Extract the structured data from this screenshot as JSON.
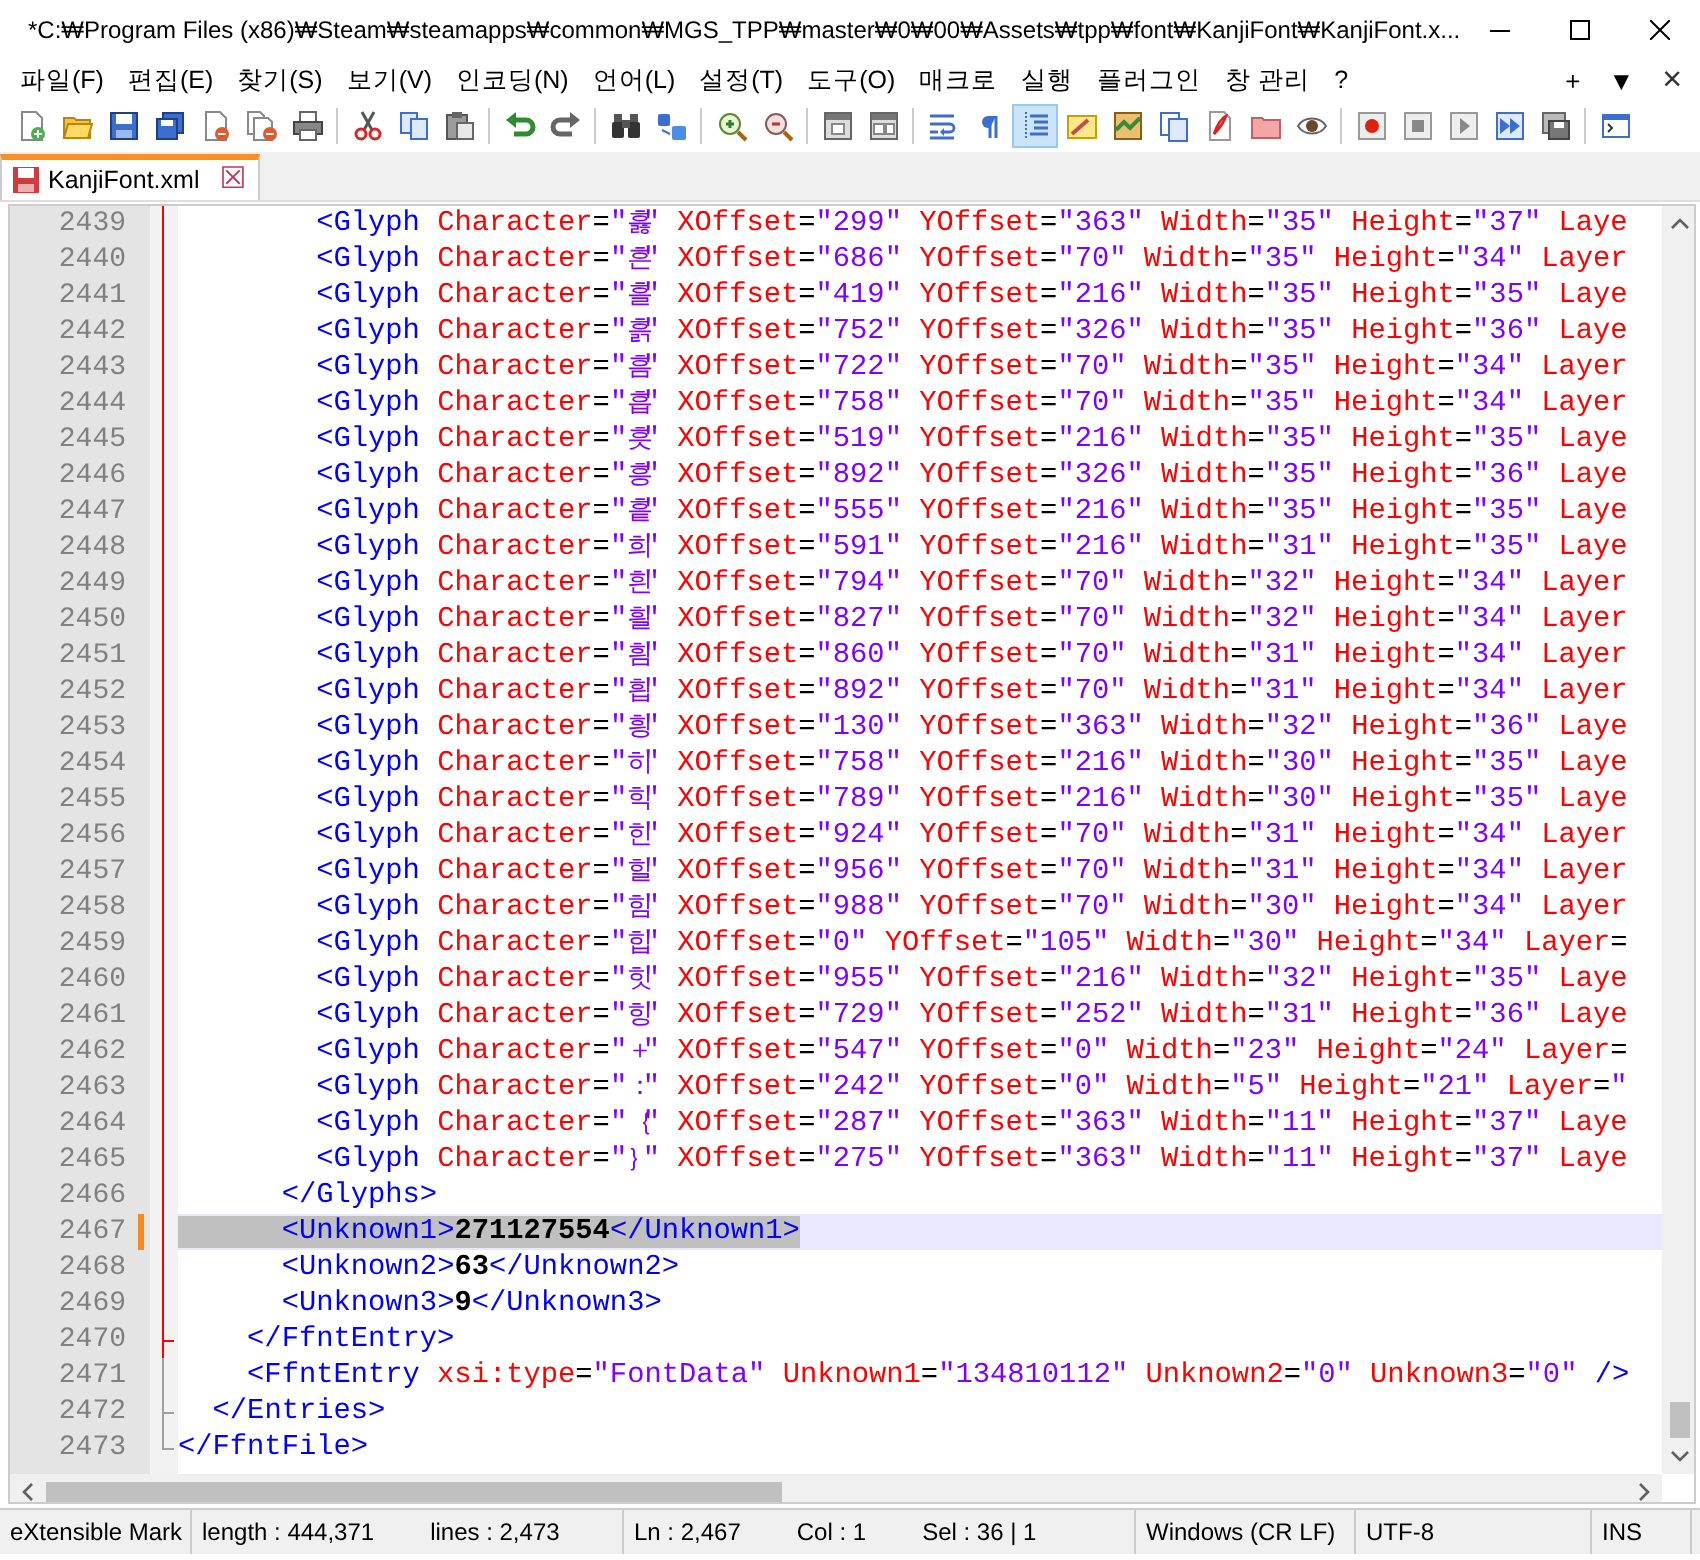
{
  "window": {
    "title": "*C:₩Program Files (x86)₩Steam₩steamapps₩common₩MGS_TPP₩master₩0₩00₩Assets₩tpp₩font₩KanjiFont₩KanjiFont.x..."
  },
  "menu": {
    "items": [
      "파일(F)",
      "편집(E)",
      "찾기(S)",
      "보기(V)",
      "인코딩(N)",
      "언어(L)",
      "설정(T)",
      "도구(O)",
      "매크로",
      "실행",
      "플러그인",
      "창 관리",
      "?"
    ],
    "right": [
      {
        "kind": "plus",
        "label": "+"
      },
      {
        "kind": "dropdown",
        "label": "▼"
      },
      {
        "kind": "close",
        "label": "×"
      }
    ]
  },
  "toolbar": {
    "groups": [
      [
        {
          "kind": "new",
          "pressed": false
        },
        {
          "kind": "open",
          "pressed": false
        },
        {
          "kind": "save",
          "pressed": false
        },
        {
          "kind": "save-all",
          "pressed": false
        },
        {
          "kind": "close",
          "pressed": false
        },
        {
          "kind": "close-all",
          "pressed": false
        },
        {
          "kind": "print",
          "pressed": false
        }
      ],
      [
        {
          "kind": "cut",
          "pressed": false
        },
        {
          "kind": "copy",
          "pressed": false
        },
        {
          "kind": "paste",
          "pressed": false
        }
      ],
      [
        {
          "kind": "undo",
          "pressed": false
        },
        {
          "kind": "redo",
          "pressed": false
        }
      ],
      [
        {
          "kind": "find",
          "pressed": false
        },
        {
          "kind": "replace",
          "pressed": false
        }
      ],
      [
        {
          "kind": "zoom-in",
          "pressed": false
        },
        {
          "kind": "zoom-out",
          "pressed": false
        }
      ],
      [
        {
          "kind": "sync-v",
          "pressed": false
        },
        {
          "kind": "sync-h",
          "pressed": false
        }
      ],
      [
        {
          "kind": "wrap",
          "pressed": false
        },
        {
          "kind": "pilcrow",
          "pressed": false
        },
        {
          "kind": "indent-guide",
          "pressed": true
        },
        {
          "kind": "user-lang",
          "pressed": false
        },
        {
          "kind": "doc-map",
          "pressed": false
        },
        {
          "kind": "func-list",
          "pressed": false
        },
        {
          "kind": "document",
          "pressed": false
        },
        {
          "kind": "folder",
          "pressed": false
        },
        {
          "kind": "eye",
          "pressed": false
        }
      ],
      [
        {
          "kind": "record",
          "pressed": false
        },
        {
          "kind": "stop",
          "pressed": false
        },
        {
          "kind": "play",
          "pressed": false
        },
        {
          "kind": "play-multi",
          "pressed": false
        },
        {
          "kind": "save-macro",
          "pressed": false
        }
      ],
      [
        {
          "kind": "console",
          "pressed": false
        }
      ]
    ]
  },
  "tabs": [
    {
      "label": "KanjiFont.xml",
      "selected": true,
      "modified": true,
      "close": "☒"
    }
  ],
  "editor": {
    "lines": [
      {
        "number": "2439",
        "kind": "inner",
        "current": false,
        "selected": false,
        "changed": false,
        "text": "        <Glyph Character=\"흟\" XOffset=\"299\" YOffset=\"363\" Width=\"35\" Height=\"37\" Laye"
      },
      {
        "number": "2440",
        "kind": "inner",
        "current": false,
        "selected": false,
        "changed": false,
        "text": "        <Glyph Character=\"흔\" XOffset=\"686\" YOffset=\"70\" Width=\"35\" Height=\"34\" Layer"
      },
      {
        "number": "2441",
        "kind": "inner",
        "current": false,
        "selected": false,
        "changed": false,
        "text": "        <Glyph Character=\"흘\" XOffset=\"419\" YOffset=\"216\" Width=\"35\" Height=\"35\" Laye"
      },
      {
        "number": "2442",
        "kind": "inner",
        "current": false,
        "selected": false,
        "changed": false,
        "text": "        <Glyph Character=\"흙\" XOffset=\"752\" YOffset=\"326\" Width=\"35\" Height=\"36\" Laye"
      },
      {
        "number": "2443",
        "kind": "inner",
        "current": false,
        "selected": false,
        "changed": false,
        "text": "        <Glyph Character=\"흠\" XOffset=\"722\" YOffset=\"70\" Width=\"35\" Height=\"34\" Layer"
      },
      {
        "number": "2444",
        "kind": "inner",
        "current": false,
        "selected": false,
        "changed": false,
        "text": "        <Glyph Character=\"흡\" XOffset=\"758\" YOffset=\"70\" Width=\"35\" Height=\"34\" Layer"
      },
      {
        "number": "2445",
        "kind": "inner",
        "current": false,
        "selected": false,
        "changed": false,
        "text": "        <Glyph Character=\"흣\" XOffset=\"519\" YOffset=\"216\" Width=\"35\" Height=\"35\" Laye"
      },
      {
        "number": "2446",
        "kind": "inner",
        "current": false,
        "selected": false,
        "changed": false,
        "text": "        <Glyph Character=\"흥\" XOffset=\"892\" YOffset=\"326\" Width=\"35\" Height=\"36\" Laye"
      },
      {
        "number": "2447",
        "kind": "inner",
        "current": false,
        "selected": false,
        "changed": false,
        "text": "        <Glyph Character=\"흩\" XOffset=\"555\" YOffset=\"216\" Width=\"35\" Height=\"35\" Laye"
      },
      {
        "number": "2448",
        "kind": "inner",
        "current": false,
        "selected": false,
        "changed": false,
        "text": "        <Glyph Character=\"희\" XOffset=\"591\" YOffset=\"216\" Width=\"31\" Height=\"35\" Laye"
      },
      {
        "number": "2449",
        "kind": "inner",
        "current": false,
        "selected": false,
        "changed": false,
        "text": "        <Glyph Character=\"흰\" XOffset=\"794\" YOffset=\"70\" Width=\"32\" Height=\"34\" Layer"
      },
      {
        "number": "2450",
        "kind": "inner",
        "current": false,
        "selected": false,
        "changed": false,
        "text": "        <Glyph Character=\"흴\" XOffset=\"827\" YOffset=\"70\" Width=\"32\" Height=\"34\" Layer"
      },
      {
        "number": "2451",
        "kind": "inner",
        "current": false,
        "selected": false,
        "changed": false,
        "text": "        <Glyph Character=\"흼\" XOffset=\"860\" YOffset=\"70\" Width=\"31\" Height=\"34\" Layer"
      },
      {
        "number": "2452",
        "kind": "inner",
        "current": false,
        "selected": false,
        "changed": false,
        "text": "        <Glyph Character=\"흽\" XOffset=\"892\" YOffset=\"70\" Width=\"31\" Height=\"34\" Layer"
      },
      {
        "number": "2453",
        "kind": "inner",
        "current": false,
        "selected": false,
        "changed": false,
        "text": "        <Glyph Character=\"힁\" XOffset=\"130\" YOffset=\"363\" Width=\"32\" Height=\"36\" Laye"
      },
      {
        "number": "2454",
        "kind": "inner",
        "current": false,
        "selected": false,
        "changed": false,
        "text": "        <Glyph Character=\"히\" XOffset=\"758\" YOffset=\"216\" Width=\"30\" Height=\"35\" Laye"
      },
      {
        "number": "2455",
        "kind": "inner",
        "current": false,
        "selected": false,
        "changed": false,
        "text": "        <Glyph Character=\"힉\" XOffset=\"789\" YOffset=\"216\" Width=\"30\" Height=\"35\" Laye"
      },
      {
        "number": "2456",
        "kind": "inner",
        "current": false,
        "selected": false,
        "changed": false,
        "text": "        <Glyph Character=\"힌\" XOffset=\"924\" YOffset=\"70\" Width=\"31\" Height=\"34\" Layer"
      },
      {
        "number": "2457",
        "kind": "inner",
        "current": false,
        "selected": false,
        "changed": false,
        "text": "        <Glyph Character=\"힐\" XOffset=\"956\" YOffset=\"70\" Width=\"31\" Height=\"34\" Layer"
      },
      {
        "number": "2458",
        "kind": "inner",
        "current": false,
        "selected": false,
        "changed": false,
        "text": "        <Glyph Character=\"힘\" XOffset=\"988\" YOffset=\"70\" Width=\"30\" Height=\"34\" Layer"
      },
      {
        "number": "2459",
        "kind": "inner",
        "current": false,
        "selected": false,
        "changed": false,
        "text": "        <Glyph Character=\"힙\" XOffset=\"0\" YOffset=\"105\" Width=\"30\" Height=\"34\" Layer="
      },
      {
        "number": "2460",
        "kind": "inner",
        "current": false,
        "selected": false,
        "changed": false,
        "text": "        <Glyph Character=\"힛\" XOffset=\"955\" YOffset=\"216\" Width=\"32\" Height=\"35\" Laye"
      },
      {
        "number": "2461",
        "kind": "inner",
        "current": false,
        "selected": false,
        "changed": false,
        "text": "        <Glyph Character=\"힝\" XOffset=\"729\" YOffset=\"252\" Width=\"31\" Height=\"36\" Laye"
      },
      {
        "number": "2462",
        "kind": "inner",
        "current": false,
        "selected": false,
        "changed": false,
        "text": "        <Glyph Character=\"＋\" XOffset=\"547\" YOffset=\"0\" Width=\"23\" Height=\"24\" Layer="
      },
      {
        "number": "2463",
        "kind": "inner",
        "current": false,
        "selected": false,
        "changed": false,
        "text": "        <Glyph Character=\"：\" XOffset=\"242\" YOffset=\"0\" Width=\"5\" Height=\"21\" Layer=\""
      },
      {
        "number": "2464",
        "kind": "inner",
        "current": false,
        "selected": false,
        "changed": false,
        "text": "        <Glyph Character=\"｛\" XOffset=\"287\" YOffset=\"363\" Width=\"11\" Height=\"37\" Laye"
      },
      {
        "number": "2465",
        "kind": "inner",
        "current": false,
        "selected": false,
        "changed": false,
        "text": "        <Glyph Character=\"｝\" XOffset=\"275\" YOffset=\"363\" Width=\"11\" Height=\"37\" Laye"
      },
      {
        "number": "2466",
        "kind": "inner",
        "current": false,
        "selected": false,
        "changed": false,
        "text": "      </Glyphs>"
      },
      {
        "number": "2467",
        "kind": "inner",
        "current": true,
        "selected": true,
        "changed": true,
        "text": "      <Unknown1>271127554</Unknown1>"
      },
      {
        "number": "2468",
        "kind": "inner",
        "current": false,
        "selected": false,
        "changed": false,
        "text": "      <Unknown2>63</Unknown2>"
      },
      {
        "number": "2469",
        "kind": "inner",
        "current": false,
        "selected": false,
        "changed": false,
        "text": "      <Unknown3>9</Unknown3>"
      },
      {
        "number": "2470",
        "kind": "inner-end",
        "current": false,
        "selected": false,
        "changed": false,
        "text": "    </FfntEntry>"
      },
      {
        "number": "2471",
        "kind": "outer",
        "current": false,
        "selected": false,
        "changed": false,
        "text": "    <FfntEntry xsi:type=\"FontData\" Unknown1=\"134810112\" Unknown2=\"0\" Unknown3=\"0\" />"
      },
      {
        "number": "2472",
        "kind": "outer-end",
        "current": false,
        "selected": false,
        "changed": false,
        "text": "  </Entries>"
      },
      {
        "number": "2473",
        "kind": "last",
        "current": false,
        "selected": false,
        "changed": false,
        "text": "</FfntFile>"
      }
    ]
  },
  "status_bar": {
    "language": "eXtensible Mark",
    "length": "length : 444,371",
    "lines": "lines : 2,473",
    "ln": "Ln : 2,467",
    "col": "Col : 1",
    "sel": "Sel : 36 | 1",
    "eol": "Windows (CR LF)",
    "encoding": "UTF-8",
    "mode": "INS"
  }
}
